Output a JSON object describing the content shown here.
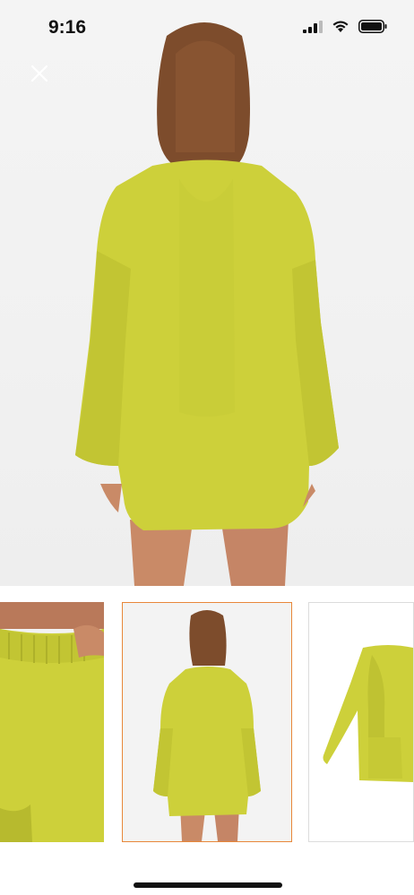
{
  "status_bar": {
    "time": "9:16",
    "icons": [
      "cellular-signal-icon",
      "wifi-icon",
      "battery-icon"
    ]
  },
  "viewer": {
    "close_icon": "close-icon",
    "selected_thumbnail_index": 1,
    "thumbnails": [
      {
        "name": "thumbnail-shorts-detail"
      },
      {
        "name": "thumbnail-back-view"
      },
      {
        "name": "thumbnail-flat-lay"
      }
    ]
  },
  "colors": {
    "garment": "#cdd03a",
    "garment_shadow": "#b7ba2e",
    "selected_border": "#e8873a",
    "skin": "#c98a67",
    "hair": "#7a4a2a"
  }
}
